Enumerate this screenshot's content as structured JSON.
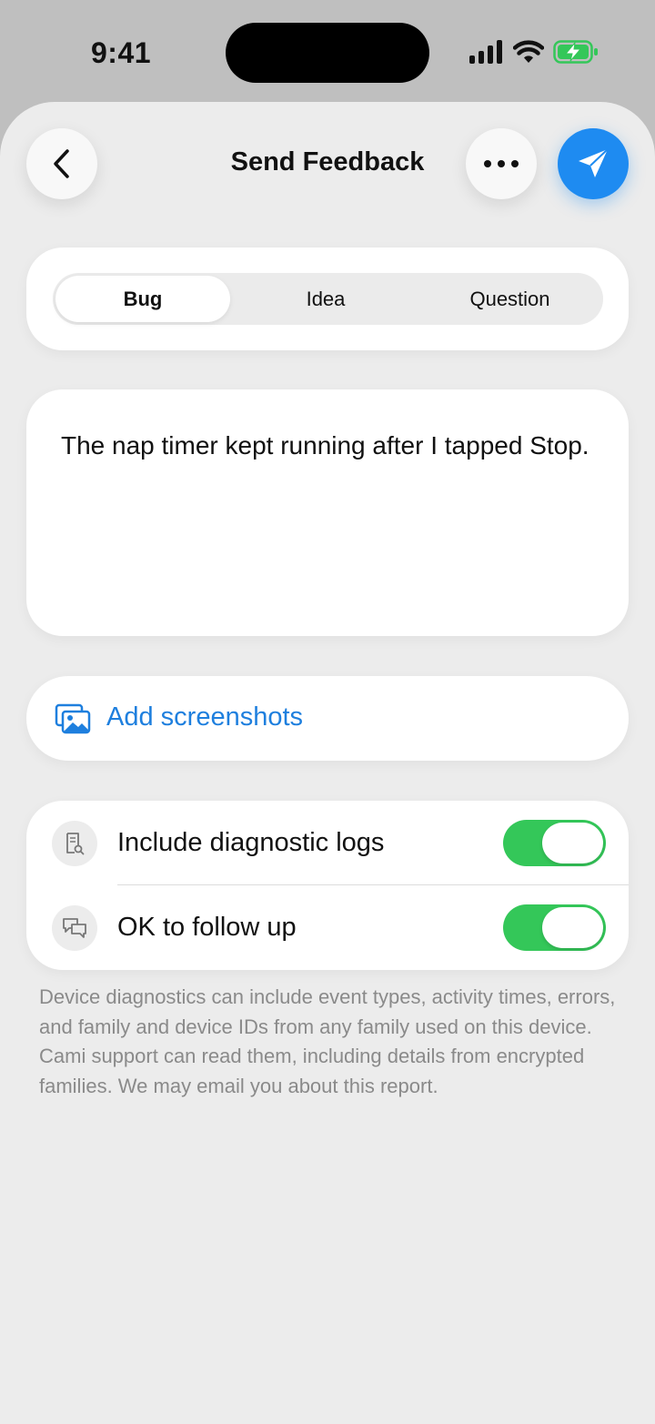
{
  "status_bar": {
    "time": "9:41"
  },
  "header": {
    "title": "Send Feedback",
    "back_icon": "chevron-left-icon",
    "more_icon": "ellipsis-icon",
    "send_icon": "paper-plane-icon",
    "accent_color": "#1e8bf1"
  },
  "segments": {
    "items": [
      {
        "label": "Bug",
        "selected": true
      },
      {
        "label": "Idea",
        "selected": false
      },
      {
        "label": "Question",
        "selected": false
      }
    ]
  },
  "feedback": {
    "value": "The nap timer kept running after I tapped Stop."
  },
  "screenshots": {
    "label": "Add screenshots",
    "icon": "photos-icon",
    "color": "#1e7fde"
  },
  "toggles": [
    {
      "label": "Include diagnostic logs",
      "icon": "document-search-icon",
      "on": true
    },
    {
      "label": "OK to follow up",
      "icon": "chat-bubbles-icon",
      "on": true
    }
  ],
  "toggle_on_color": "#34c759",
  "footnote": "Device diagnostics can include event types, activity times, errors, and family and device IDs from any family used on this device. Cami support can read them, including details from encrypted families. We may email you about this report."
}
